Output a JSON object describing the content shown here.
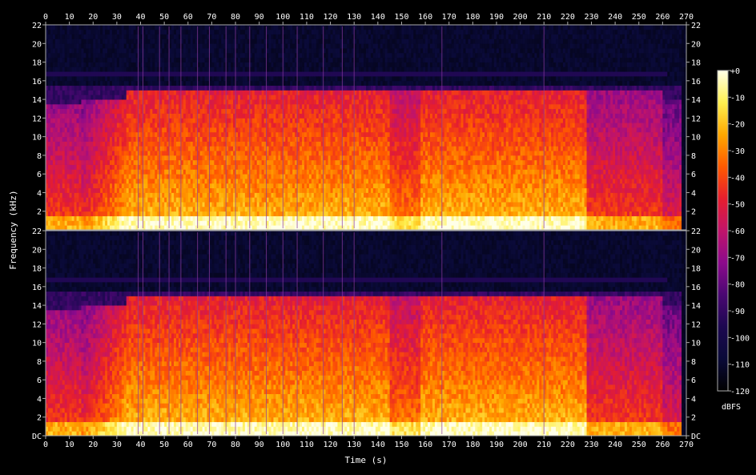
{
  "chart_data": {
    "type": "heatmap",
    "x_axis": {
      "label": "Time (s)",
      "unit": "s",
      "range": [
        0,
        270
      ],
      "ticks": [
        0,
        10,
        20,
        30,
        40,
        50,
        60,
        70,
        80,
        90,
        100,
        110,
        120,
        130,
        140,
        150,
        160,
        170,
        180,
        190,
        200,
        210,
        220,
        230,
        240,
        250,
        260,
        270
      ]
    },
    "y_axis": {
      "label": "Frequency (kHz)",
      "unit": "kHz",
      "range": [
        0,
        22
      ],
      "ticks_top_channel": [
        "2",
        "4",
        "6",
        "8",
        "10",
        "12",
        "14",
        "16",
        "18",
        "20",
        "22"
      ],
      "ticks_bottom_channel": [
        "DC",
        "2",
        "4",
        "6",
        "8",
        "10",
        "12",
        "14",
        "16",
        "18",
        "20",
        "22"
      ]
    },
    "colorbar": {
      "label": "dBFS",
      "range": [
        -120,
        0
      ],
      "ticks": [
        "+0",
        "-10",
        "-20",
        "-30",
        "-40",
        "-50",
        "-60",
        "-70",
        "-80",
        "-90",
        "-100",
        "-110",
        "-120"
      ],
      "stops": [
        "#ffffe8",
        "#fff050",
        "#ffa800",
        "#ff5a00",
        "#e61e2e",
        "#c0146a",
        "#8c0a8c",
        "#4a0872",
        "#1c0850",
        "#0a0a38",
        "#000000"
      ]
    },
    "channels": 2,
    "spectral_profile": {
      "lowpass_cutoff_kHz": 15,
      "faint_band_kHz": 16.5,
      "segments": [
        {
          "start": 0,
          "end": 15,
          "level": "moderate",
          "upper_kHz": 13.5
        },
        {
          "start": 15,
          "end": 34,
          "level": "rising",
          "upper_kHz": 14
        },
        {
          "start": 34,
          "end": 145,
          "level": "loud",
          "upper_kHz": 15
        },
        {
          "start": 145,
          "end": 158,
          "level": "dip",
          "upper_kHz": 15
        },
        {
          "start": 158,
          "end": 228,
          "level": "loud",
          "upper_kHz": 15
        },
        {
          "start": 228,
          "end": 260,
          "level": "moderate",
          "upper_kHz": 15
        },
        {
          "start": 260,
          "end": 268,
          "level": "fade",
          "upper_kHz": 14
        }
      ],
      "transient_lines_s": [
        39,
        41,
        48,
        52,
        57,
        64,
        69,
        76,
        80,
        86,
        93,
        100,
        106,
        117,
        125,
        130,
        167,
        210
      ]
    }
  }
}
